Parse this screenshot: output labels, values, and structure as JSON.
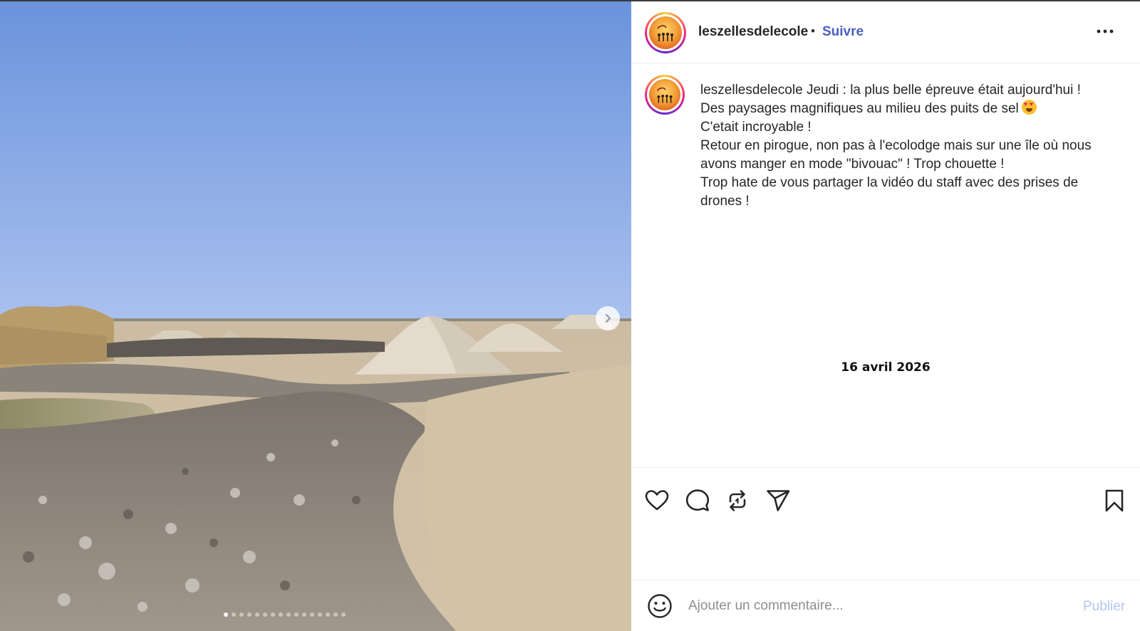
{
  "post": {
    "username": "leszellesdelecole",
    "separator": "•",
    "follow_label": "Suivre",
    "more_icon": "more-horizontal-icon",
    "caption_user": "leszellesdelecole",
    "caption_lines": [
      "Jeudi : la plus belle épreuve était aujourd'hui !",
      "Des paysages magnifiques au milieu des puits de sel",
      "C'etait incroyable !",
      "Retour en pirogue, non pas à l'ecolodge mais sur une île où nous avons manger en mode \"bivouac\" ! Trop chouette !",
      "Trop hate de vous partager la vidéo du staff avec des prises de drones !"
    ],
    "caption_emoji": "smiling-face-with-heart-eyes",
    "date": "16 avril 2026"
  },
  "carousel": {
    "next_icon": "chevron-right-icon",
    "slide_count": 16,
    "active_slide": 1
  },
  "actions": {
    "like_icon": "heart-icon",
    "comment_icon": "comment-icon",
    "repost_icon": "repost-icon",
    "share_icon": "send-icon",
    "save_icon": "bookmark-icon"
  },
  "comment": {
    "emoji_icon": "smiley-icon",
    "placeholder": "Ajouter un commentaire...",
    "publish_label": "Publier"
  },
  "colors": {
    "follow": "#4a5fc1",
    "publish_disabled": "#b2c6f0",
    "sky_top": "#6e96de",
    "sky_bottom": "#a9c0ee"
  }
}
